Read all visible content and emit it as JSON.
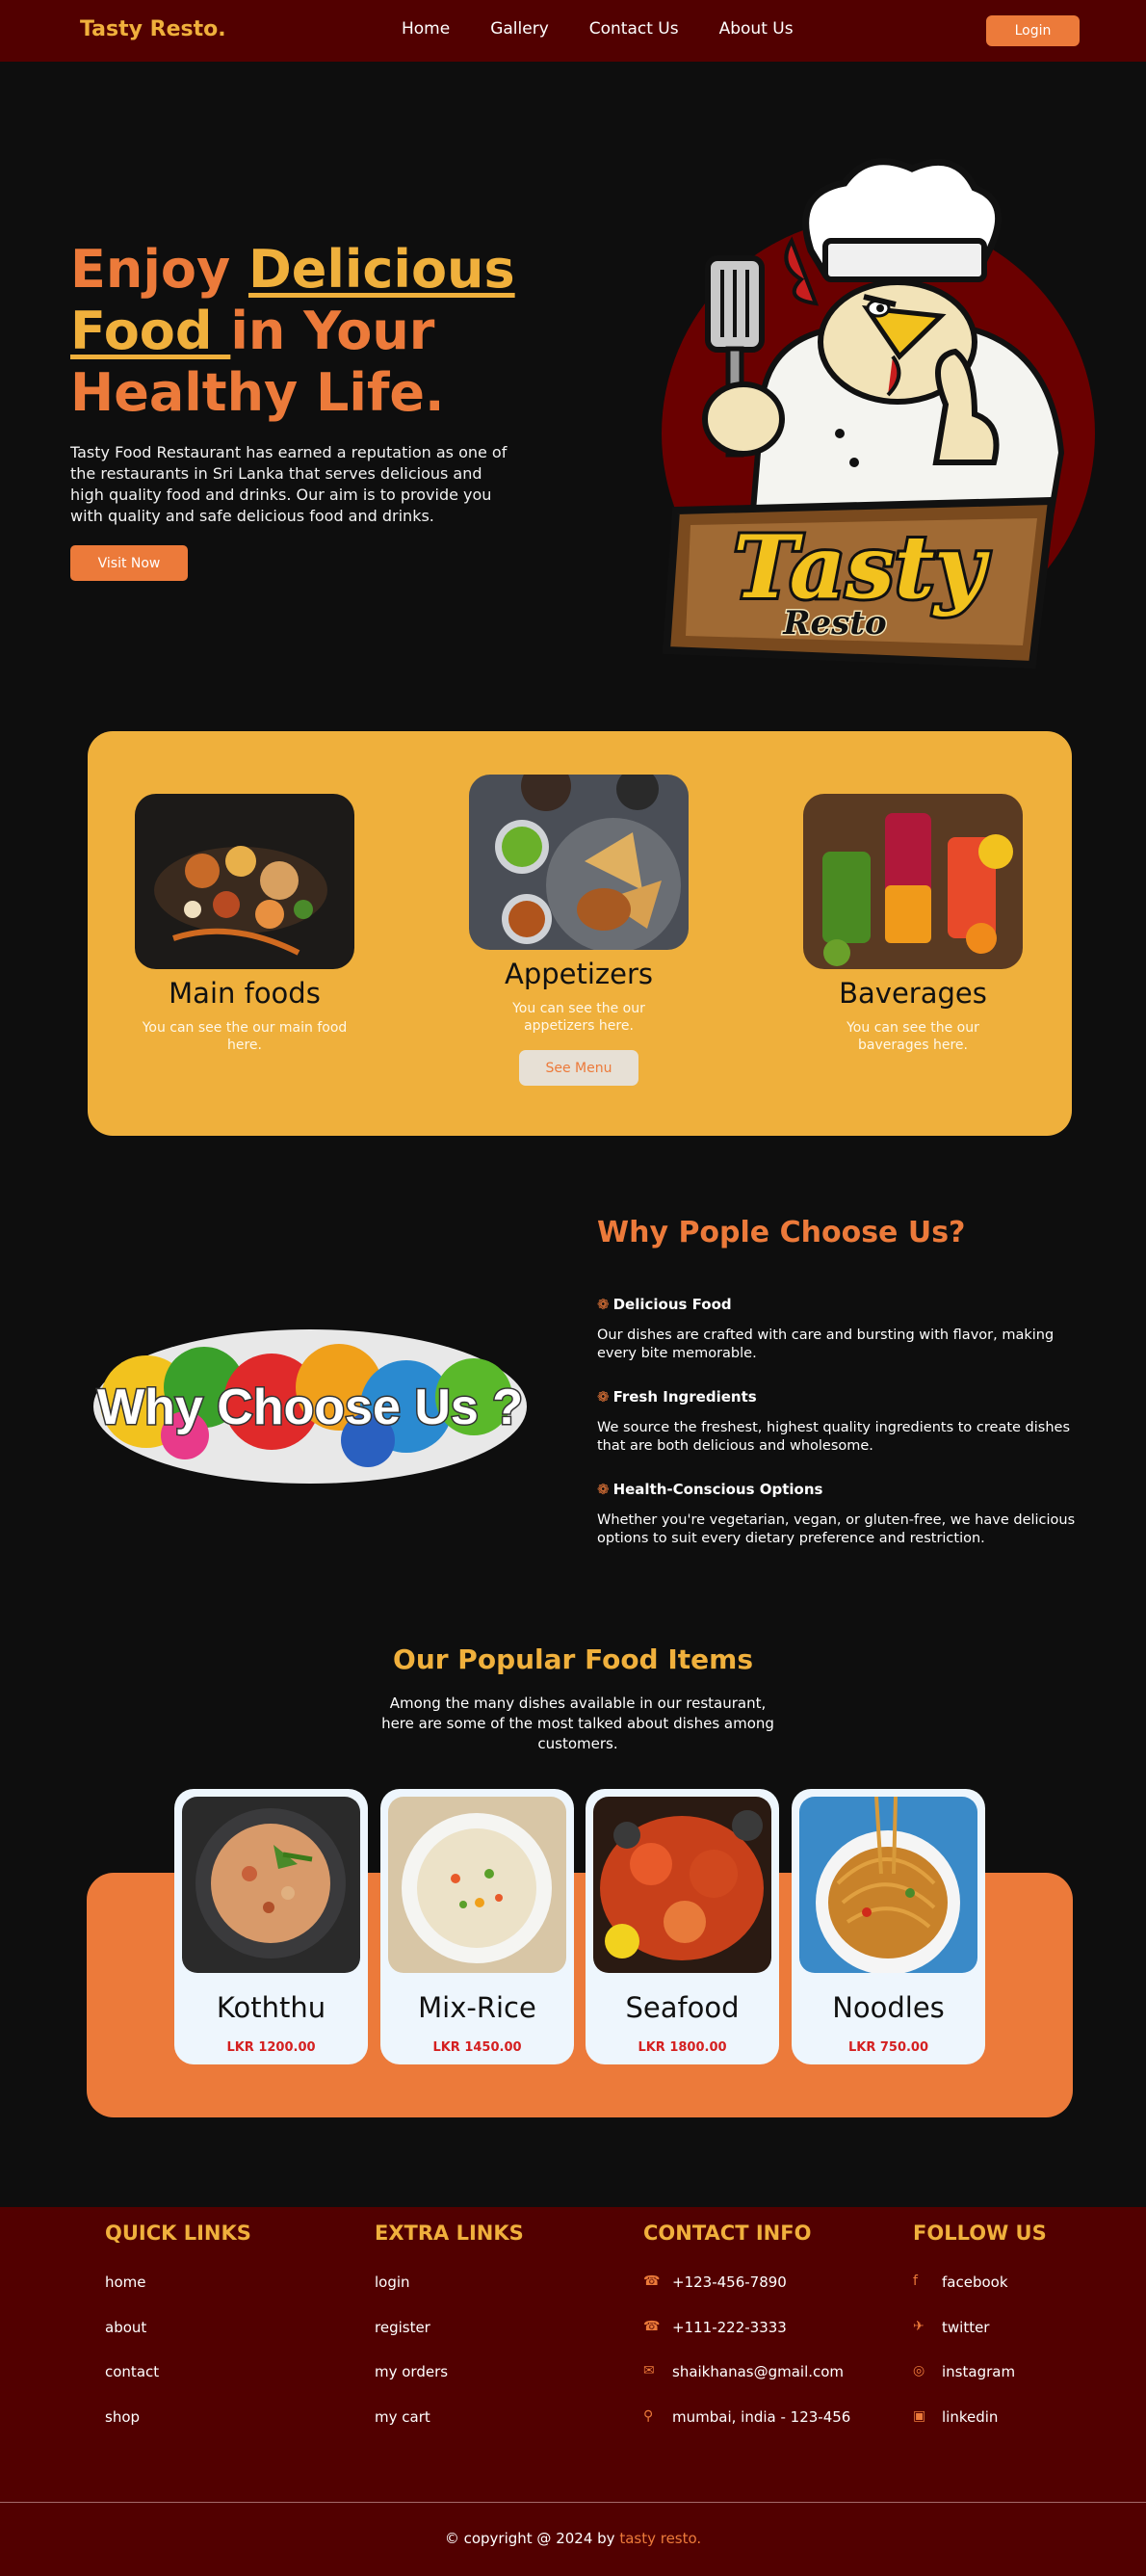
{
  "nav": {
    "brand": "Tasty Resto.",
    "links": [
      "Home",
      "Gallery",
      "Contact Us",
      "About Us"
    ],
    "login": "Login"
  },
  "hero": {
    "title_part1": "Enjoy ",
    "title_highlight": "Delicious Food ",
    "title_part2": "in Your Healthy Life.",
    "text": "Tasty Food Restaurant has earned a reputation as one of the restaurants in Sri Lanka that serves delicious and high quality food and drinks. Our aim is to provide you with quality and safe delicious food and drinks.",
    "button": "Visit Now",
    "logo_text_1": "Tasty",
    "logo_text_2": "Resto"
  },
  "categories": [
    {
      "title": "Main foods",
      "desc": "You can see the our main food here."
    },
    {
      "title": "Appetizers",
      "desc": "You can see the our appetizers here.",
      "button": "See Menu"
    },
    {
      "title": "Baverages",
      "desc": "You can see the our baverages here."
    }
  ],
  "why": {
    "image_text": "Why Choose Us ?",
    "title": "Why Pople Choose Us?",
    "items": [
      {
        "head": "Delicious Food",
        "body": "Our dishes are crafted with care and bursting with flavor, making every bite memorable."
      },
      {
        "head": "Fresh Ingredients",
        "body": "We source the freshest, highest quality ingredients to create dishes that are both delicious and wholesome."
      },
      {
        "head": "Health-Conscious Options",
        "body": "Whether you're vegetarian, vegan, or gluten-free, we have delicious options to suit every dietary preference and restriction."
      }
    ]
  },
  "popular": {
    "title": "Our Popular Food Items",
    "subtitle": "Among the many dishes available in our restaurant, here are some of the most talked about dishes among customers.",
    "items": [
      {
        "name": "Koththu",
        "price": "LKR 1200.00"
      },
      {
        "name": "Mix-Rice",
        "price": "LKR 1450.00"
      },
      {
        "name": "Seafood",
        "price": "LKR 1800.00"
      },
      {
        "name": "Noodles",
        "price": "LKR 750.00"
      }
    ]
  },
  "footer": {
    "quick": {
      "title": "QUICK LINKS",
      "items": [
        "home",
        "about",
        "contact",
        "shop"
      ]
    },
    "extra": {
      "title": "EXTRA LINKS",
      "items": [
        "login",
        "register",
        "my orders",
        "my cart"
      ]
    },
    "contact": {
      "title": "CONTACT INFO",
      "items": [
        "+123-456-7890",
        "+111-222-3333",
        "shaikhanas@gmail.com",
        "mumbai, india - 123-456"
      ],
      "icons": [
        "phone-icon",
        "phone-icon",
        "envelope-icon",
        "map-pin-icon"
      ]
    },
    "follow": {
      "title": "FOLLOW US",
      "items": [
        "facebook",
        "twitter",
        "instagram",
        "linkedin"
      ],
      "icons": [
        "facebook-icon",
        "twitter-icon",
        "instagram-icon",
        "linkedin-icon"
      ]
    },
    "copyright": "© copyright @ 2024 by ",
    "copyright_brand": "tasty resto."
  },
  "colors": {
    "nav_bg": "#520000",
    "accent_orange": "#ec7a3a",
    "accent_yellow": "#f0b03c",
    "page_bg": "#0e0e0e",
    "price_red": "#d42020"
  }
}
